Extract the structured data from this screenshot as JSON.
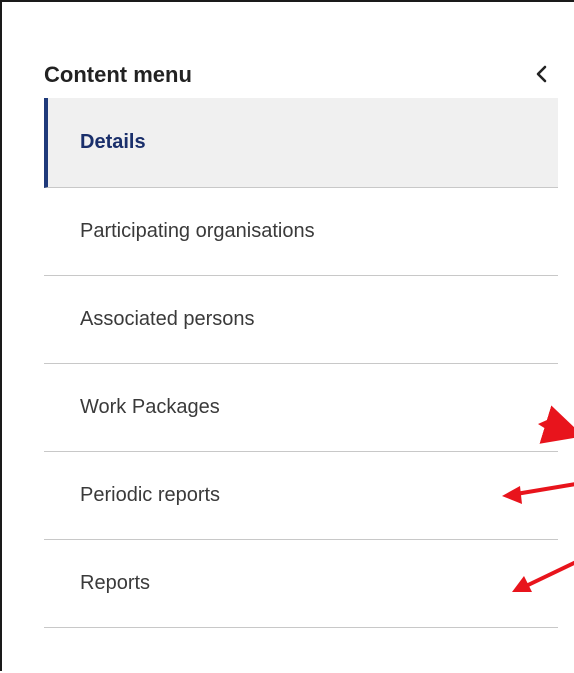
{
  "menu": {
    "title": "Content menu",
    "collapse_icon": "chevron-left-icon",
    "items": [
      {
        "label": "Details",
        "active": true
      },
      {
        "label": "Participating organisations",
        "active": false
      },
      {
        "label": "Associated persons",
        "active": false
      },
      {
        "label": "Work Packages",
        "active": false
      },
      {
        "label": "Periodic reports",
        "active": false
      },
      {
        "label": "Reports",
        "active": false
      }
    ]
  },
  "colors": {
    "active_text": "#1a2f6b",
    "active_indicator": "#1f3a7a",
    "active_background": "#f0f0f0",
    "annotation_arrow": "#e8141c",
    "divider": "#c8c8c8"
  }
}
